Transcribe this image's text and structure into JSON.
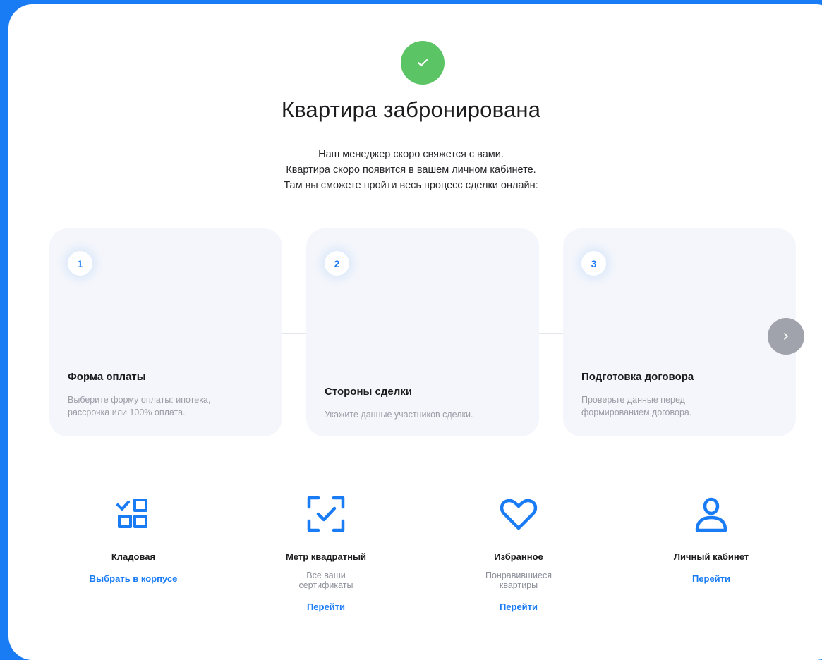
{
  "header": {
    "title": "Квартира забронирована",
    "subtitle_lines": [
      "Наш менеджер скоро свяжется с вами.",
      "Квартира скоро появится в вашем личном кабинете.",
      "Там вы сможете пройти весь процесс сделки онлайн:"
    ]
  },
  "steps": [
    {
      "number": "1",
      "title": "Форма оплаты",
      "desc_lines": [
        "Выберите форму оплаты: ипотека,",
        "рассрочка или 100% оплата."
      ]
    },
    {
      "number": "2",
      "title": "Стороны сделки",
      "desc_lines": [
        "Укажите данные участников сделки."
      ]
    },
    {
      "number": "3",
      "title": "Подготовка договора",
      "desc_lines": [
        "Проверьте данные перед",
        "формированием договора."
      ]
    }
  ],
  "features": [
    {
      "icon": "storage-grid-icon",
      "title": "Кладовая",
      "desc_lines": [],
      "link": "Выбрать в корпусе"
    },
    {
      "icon": "scan-check-icon",
      "title": "Метр квадратный",
      "desc_lines": [
        "Все ваши",
        "сертификаты"
      ],
      "link": "Перейти"
    },
    {
      "icon": "heart-icon",
      "title": "Избранное",
      "desc_lines": [
        "Понравившиеся",
        "квартиры"
      ],
      "link": "Перейти"
    },
    {
      "icon": "user-icon",
      "title": "Личный кабинет",
      "desc_lines": [],
      "link": "Перейти"
    }
  ],
  "colors": {
    "accent": "#1a7cf5",
    "success": "#5bc464",
    "card_bg": "#f4f6fb"
  }
}
